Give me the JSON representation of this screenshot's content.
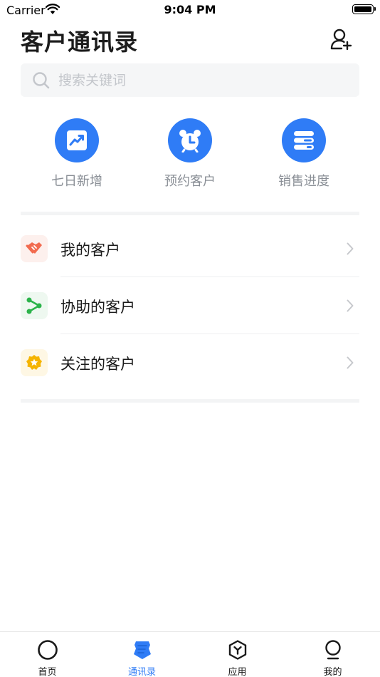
{
  "status_bar": {
    "carrier": "Carrier",
    "time": "9:04 PM"
  },
  "header": {
    "title": "客户通讯录",
    "add_icon": "add-user-icon"
  },
  "search": {
    "placeholder": "搜索关键词",
    "value": ""
  },
  "shortcuts": [
    {
      "label": "七日新增",
      "icon": "trend-chart-icon"
    },
    {
      "label": "预约客户",
      "icon": "alarm-clock-icon"
    },
    {
      "label": "销售进度",
      "icon": "progress-bars-icon"
    }
  ],
  "customer_list": [
    {
      "label": "我的客户",
      "icon": "handshake-icon",
      "color": "#f26b4f"
    },
    {
      "label": "协助的客户",
      "icon": "share-nodes-icon",
      "color": "#2bb34a"
    },
    {
      "label": "关注的客户",
      "icon": "star-badge-icon",
      "color": "#f5b400"
    }
  ],
  "tabbar": {
    "items": [
      {
        "label": "首页",
        "icon": "home-circle-icon",
        "active": false
      },
      {
        "label": "通讯录",
        "icon": "contacts-badge-icon",
        "active": true
      },
      {
        "label": "应用",
        "icon": "apps-hexagon-icon",
        "active": false
      },
      {
        "label": "我的",
        "icon": "profile-icon",
        "active": false
      }
    ]
  },
  "colors": {
    "accent": "#2f7cf6",
    "text_primary": "#1a1a1a",
    "text_secondary": "#8a8f96",
    "search_bg": "#f5f6f7"
  }
}
